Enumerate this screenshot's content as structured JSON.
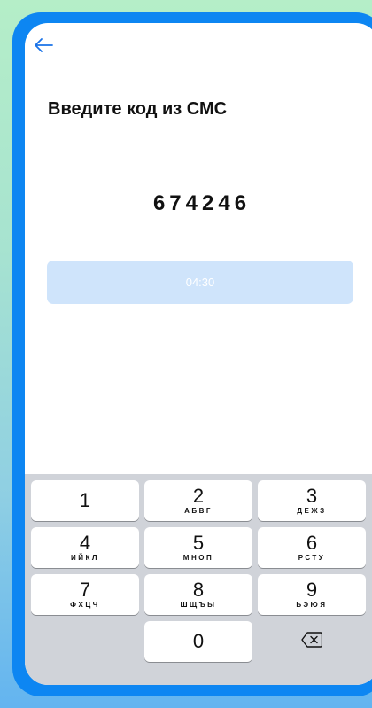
{
  "header": {
    "back_icon": "arrow-left-icon"
  },
  "title": "Введите код из СМС",
  "code": "674246",
  "timer": "04:30",
  "colors": {
    "frame": "#0d86f2",
    "accent": "#1a73e8",
    "timer_button_bg": "#cfe4fb",
    "keyboard_bg": "#d0d3d9"
  },
  "keypad": {
    "keys": [
      {
        "digit": "1",
        "letters": ""
      },
      {
        "digit": "2",
        "letters": "АБВГ"
      },
      {
        "digit": "3",
        "letters": "ДЕЖЗ"
      },
      {
        "digit": "4",
        "letters": "ИЙКЛ"
      },
      {
        "digit": "5",
        "letters": "МНОП"
      },
      {
        "digit": "6",
        "letters": "РСТУ"
      },
      {
        "digit": "7",
        "letters": "ФХЦЧ"
      },
      {
        "digit": "8",
        "letters": "ШЩЪЫ"
      },
      {
        "digit": "9",
        "letters": "ЬЭЮЯ"
      },
      {
        "digit": "0",
        "letters": ""
      }
    ],
    "delete_icon": "backspace-icon"
  }
}
